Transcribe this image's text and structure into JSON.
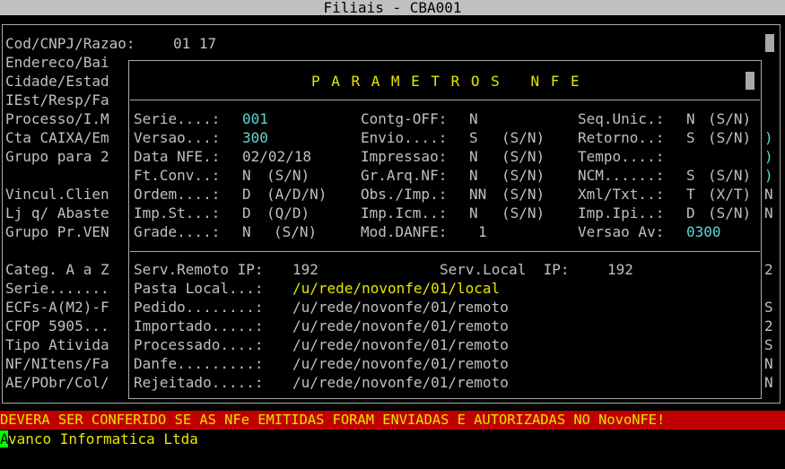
{
  "window": {
    "title": "Filiais - CBA001"
  },
  "background_form": {
    "header_label": "Cod/CNPJ/Razao:",
    "header_value": "01 17",
    "labels": [
      "Endereco/Bai",
      "Cidade/Estad",
      "IEst/Resp/Fa",
      "Processo/I.M",
      "Cta CAIXA/Em",
      "Grupo para 2",
      "",
      "Vincul.Clien",
      "Lj q/ Abaste",
      "Grupo Pr.VEN",
      "",
      "Categ. A a Z",
      "Serie.......",
      "ECFs-A(M2)-F",
      "CFOP 5905...",
      "Tipo Ativida",
      "NF/NItens/Fa",
      "AE/PObr/Col/"
    ],
    "right_edge": [
      "",
      ")",
      ")",
      ")",
      "N",
      "N",
      "",
      "",
      "2",
      "",
      "S",
      "2",
      "S",
      "N",
      "N"
    ]
  },
  "dialog": {
    "title": "PARAMETROS NFE",
    "rows": [
      [
        {
          "label": "Serie....:",
          "value": "001",
          "hint": ""
        },
        {
          "label": "Contg-OFF:",
          "value": "N",
          "hint": ""
        },
        {
          "label": "Seq.Unic.:",
          "value": "N",
          "hint": "(S/N)"
        }
      ],
      [
        {
          "label": "Versao...:",
          "value": "300",
          "hint": ""
        },
        {
          "label": "Envio....:",
          "value": "S",
          "hint": "(S/N)"
        },
        {
          "label": "Retorno..:",
          "value": "S",
          "hint": "(S/N)"
        }
      ],
      [
        {
          "label": "Data NFE.:",
          "value": "02/02/18",
          "hint": ""
        },
        {
          "label": "Impressao:",
          "value": "N",
          "hint": "(S/N)"
        },
        {
          "label": "Tempo....:",
          "value": "",
          "hint": ""
        }
      ],
      [
        {
          "label": "Ft.Conv..:",
          "value": "N",
          "hint": "(S/N)"
        },
        {
          "label": "Gr.Arq.NF:",
          "value": "N",
          "hint": "(S/N)"
        },
        {
          "label": "NCM......:",
          "value": "S",
          "hint": "(S/N)"
        }
      ],
      [
        {
          "label": "Ordem....:",
          "value": "D",
          "hint": "(A/D/N)"
        },
        {
          "label": "Obs./Imp.:",
          "value": "NN",
          "hint": "(S/N)"
        },
        {
          "label": "Xml/Txt..:",
          "value": "T",
          "hint": "(X/T)"
        }
      ],
      [
        {
          "label": "Imp.St...:",
          "value": "D",
          "hint": "(Q/D)"
        },
        {
          "label": "Imp.Icm..:",
          "value": "N",
          "hint": "(S/N)"
        },
        {
          "label": "Imp.Ipi..:",
          "value": "D",
          "hint": "(S/N)"
        }
      ],
      [
        {
          "label": "Grade....:",
          "value": "N",
          "hint": "(S/N)"
        },
        {
          "label": "Mod.DANFE:",
          "value": "1",
          "hint": ""
        },
        {
          "label": "Versao Av:",
          "value": "0300",
          "hint": ""
        }
      ]
    ],
    "serv_remoto_label": "Serv.Remoto IP:",
    "serv_remoto_value": "192",
    "serv_local_label": "Serv.Local  IP:",
    "serv_local_value": "192",
    "paths": [
      {
        "label": "Pasta Local...:",
        "value": "/u/rede/novonfe/01/local"
      },
      {
        "label": "Pedido........:",
        "value": "/u/rede/novonfe/01/remoto"
      },
      {
        "label": "Importado.....:",
        "value": "/u/rede/novonfe/01/remoto"
      },
      {
        "label": "Processado....:",
        "value": "/u/rede/novonfe/01/remoto"
      },
      {
        "label": "Danfe.........:",
        "value": "/u/rede/novonfe/01/remoto"
      },
      {
        "label": "Rejeitado.....:",
        "value": "/u/rede/novonfe/01/remoto"
      }
    ]
  },
  "warning": "DEVERA SER CONFERIDO SE AS NFe EMITIDAS FORAM ENVIADAS E AUTORIZADAS NO NovoNFE!",
  "footer": {
    "cursor_char": "A",
    "text": "vanco Informatica Ltda"
  },
  "colors": {
    "value_cyan": "#5fd7d7",
    "yellow": "#e6e600",
    "warning_bg": "#c00000",
    "cursor": "#00ff00"
  }
}
